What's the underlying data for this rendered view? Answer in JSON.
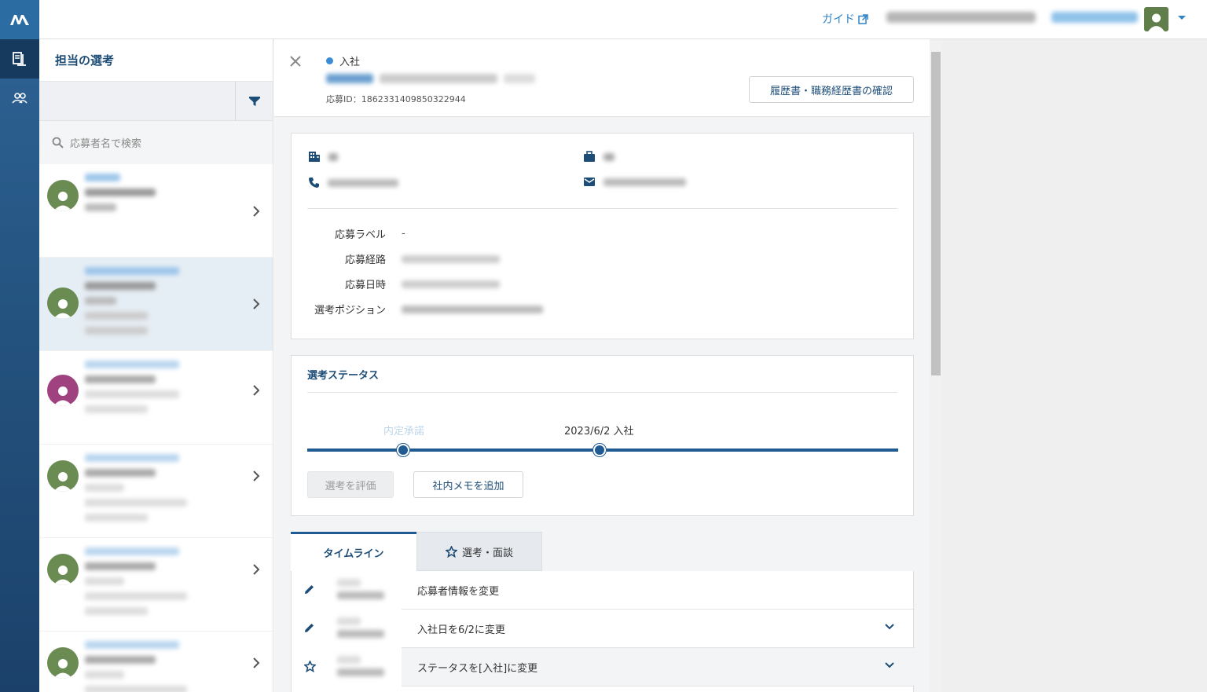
{
  "header": {
    "guide_label": "ガイド"
  },
  "list_panel": {
    "title": "担当の選考",
    "search_placeholder": "応募者名で検索",
    "avatar_colors": [
      "#6a8b52",
      "#6a8b52",
      "#a0427f",
      "#6a8b52",
      "#6a8b52",
      "#6a8b52"
    ]
  },
  "detail": {
    "status": "入社",
    "application_id": "応募ID：1862331409850322944",
    "resume_button": "履歴書・職務経歴書の確認",
    "fields": {
      "label_label": "応募ラベル",
      "label_value": "-",
      "route_label": "応募経路",
      "date_label": "応募日時",
      "position_label": "選考ポジション"
    },
    "selection": {
      "title": "選考ステータス",
      "stage_prev": "内定承諾",
      "stage_current": "2023/6/2 入社",
      "evaluate_button": "選考を評価",
      "memo_button": "社内メモを追加"
    },
    "tabs": {
      "timeline": "タイムライン",
      "interview": "選考・面談"
    },
    "timeline": [
      {
        "text": "応募者情報を変更"
      },
      {
        "text": "入社日を6/2に変更"
      },
      {
        "text": "ステータスを[入社]に変更"
      }
    ]
  }
}
